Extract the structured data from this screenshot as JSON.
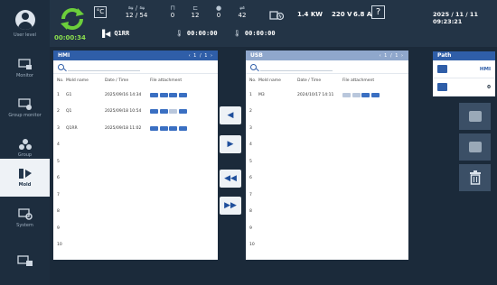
{
  "header": {
    "user_label": "User level",
    "timer": "00:00:34",
    "unit_toggle": "°C",
    "counter_a": "12 / 54",
    "counter_b": "0",
    "counter_c": "12",
    "counter_d": "0",
    "counter_e": "42",
    "power": "1.4 KW",
    "voltage": "220 V",
    "current": "6.8 A",
    "help_label": "?",
    "datetime": "2025 / 11 / 11  09:23:21",
    "mold_name": "Q1RR",
    "timer1": "00:00:00",
    "timer2": "00:00:00"
  },
  "sidebar": {
    "items": [
      {
        "label": "Monitor",
        "icon": "monitor-icon"
      },
      {
        "label": "Group monitor",
        "icon": "group-monitor-icon"
      },
      {
        "label": "Group",
        "icon": "group-icon"
      },
      {
        "label": "Mold",
        "icon": "mold-icon"
      },
      {
        "label": "System",
        "icon": "system-icon"
      }
    ],
    "active": "Mold"
  },
  "hmi": {
    "title": "HMI",
    "page": "1 / 1",
    "search_placeholder": "",
    "columns": [
      "No.",
      "Mold name",
      "Date / Time",
      "File attachment"
    ],
    "rows": [
      {
        "no": "1",
        "name": "G1",
        "date": "2025/09/16 14:34"
      },
      {
        "no": "2",
        "name": "Q1",
        "date": "2025/09/18 10:54"
      },
      {
        "no": "3",
        "name": "Q1RR",
        "date": "2025/09/18 11:02"
      },
      {
        "no": "4",
        "name": "",
        "date": ""
      },
      {
        "no": "5",
        "name": "",
        "date": ""
      },
      {
        "no": "6",
        "name": "",
        "date": ""
      },
      {
        "no": "7",
        "name": "",
        "date": ""
      },
      {
        "no": "8",
        "name": "",
        "date": ""
      },
      {
        "no": "9",
        "name": "",
        "date": ""
      },
      {
        "no": "10",
        "name": "",
        "date": ""
      }
    ]
  },
  "usb": {
    "title": "USB",
    "page": "1 / 1",
    "columns": [
      "No.",
      "Mold name",
      "Date / Time",
      "File attachment"
    ],
    "rows": [
      {
        "no": "1",
        "name": "M3",
        "date": "2024/10/17 14:11"
      },
      {
        "no": "2",
        "name": "",
        "date": ""
      },
      {
        "no": "3",
        "name": "",
        "date": ""
      },
      {
        "no": "4",
        "name": "",
        "date": ""
      },
      {
        "no": "5",
        "name": "",
        "date": ""
      },
      {
        "no": "6",
        "name": "",
        "date": ""
      },
      {
        "no": "7",
        "name": "",
        "date": ""
      },
      {
        "no": "8",
        "name": "",
        "date": ""
      },
      {
        "no": "9",
        "name": "",
        "date": ""
      },
      {
        "no": "10",
        "name": "",
        "date": ""
      }
    ]
  },
  "path": {
    "title": "Path",
    "hmi_label": "HMI",
    "usb_value": "0"
  },
  "colors": {
    "accent": "#2f5ea8",
    "background": "#1b2a3a",
    "timer_green": "#8be04e"
  }
}
